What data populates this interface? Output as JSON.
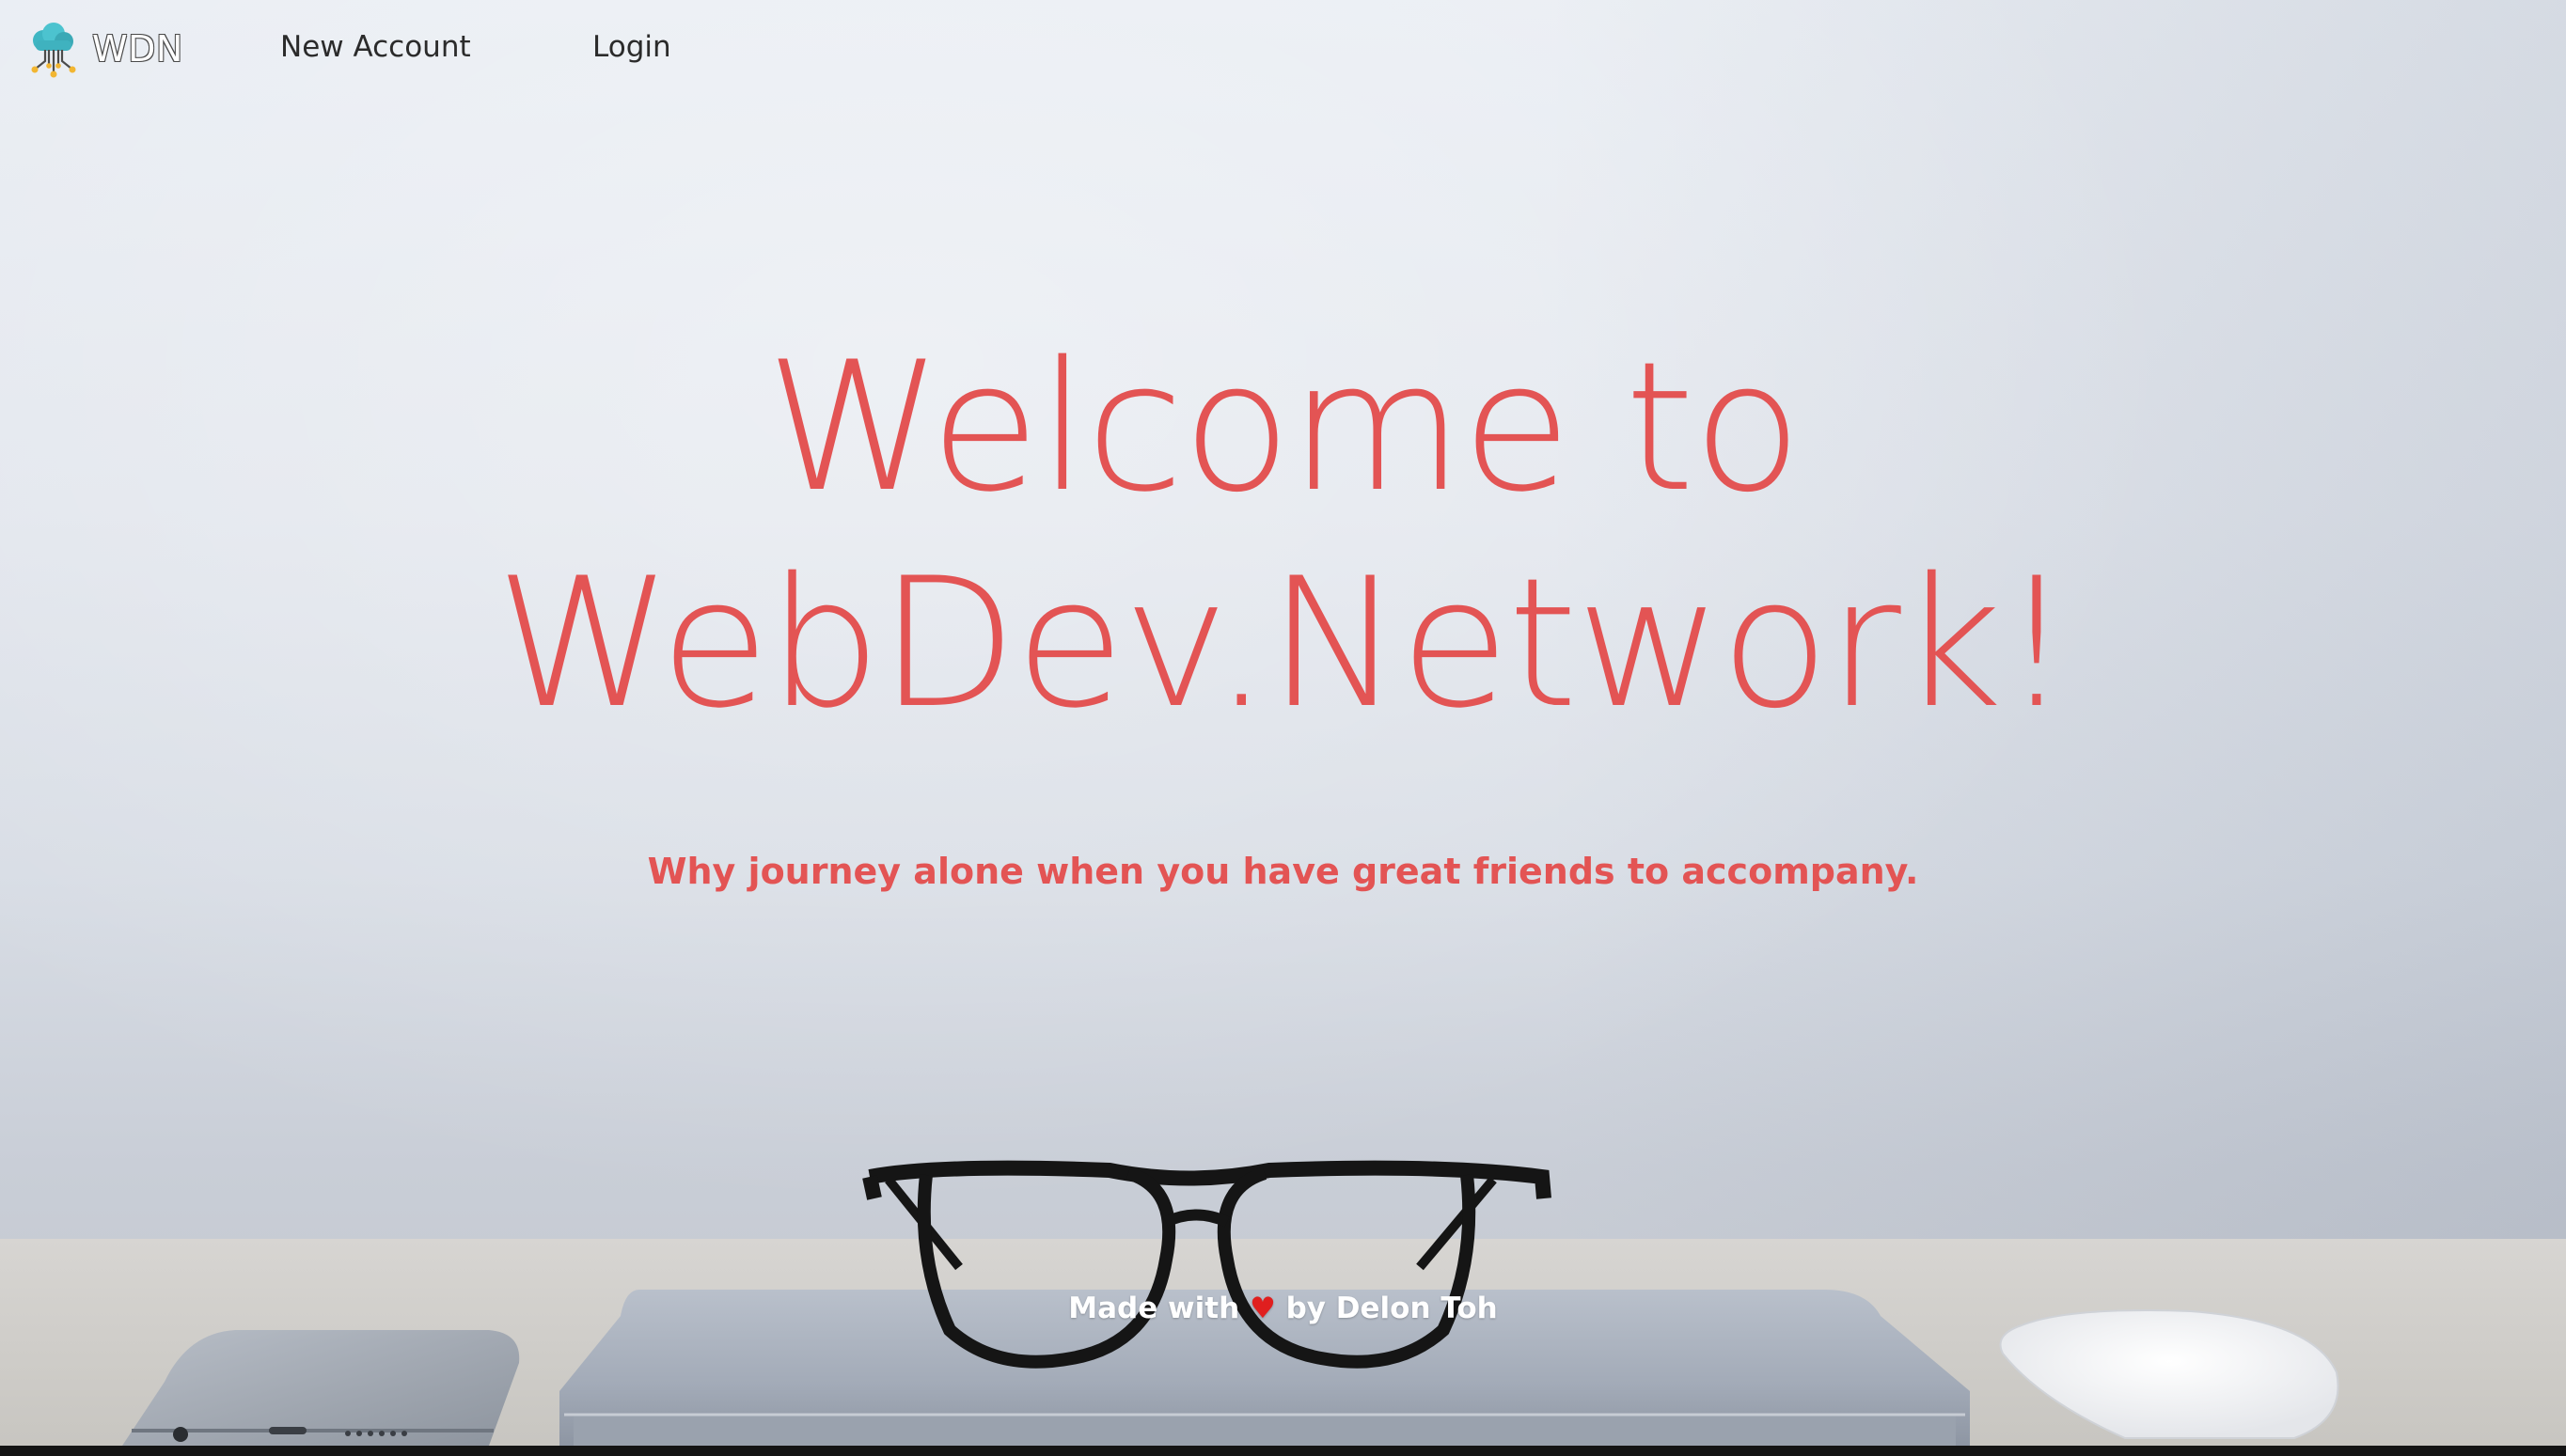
{
  "navbar": {
    "brand_text": "WDN",
    "links": [
      {
        "label": "New Account"
      },
      {
        "label": "Login"
      }
    ]
  },
  "hero": {
    "title_line1": "Welcome to",
    "title_line2": "WebDev.Network!",
    "subtitle": "Why journey alone when you have great friends to accompany.",
    "accent_color": "#e35454"
  },
  "footer": {
    "made_with": "Made with",
    "heart": "♥",
    "by": "by Delon Toh"
  },
  "icons": {
    "logo": "cloud-network-icon",
    "heart": "heart-icon"
  },
  "background": {
    "description_tag": "desk-with-glasses-laptop-phone-mouse",
    "colors": {
      "wall": "#e2e6ed",
      "desk": "#d1cfcb"
    }
  }
}
